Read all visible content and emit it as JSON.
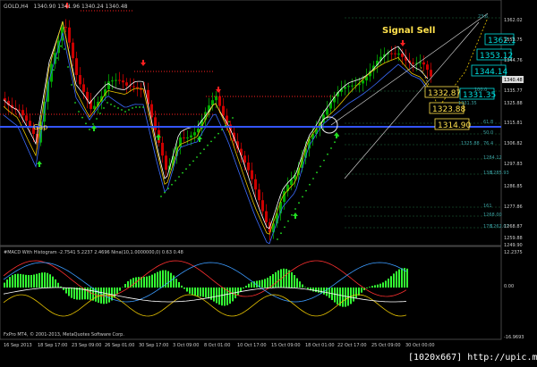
{
  "header": {
    "symbol": "GOLD,H4",
    "ohlc": "1340.90 1341.96 1340.24 1340.48"
  },
  "annotations": {
    "signal": "Signal Sell",
    "gap": "Gap"
  },
  "price_boxes": [
    {
      "label": "1362.1"
    },
    {
      "label": "1353.12"
    },
    {
      "label": "1344.14"
    },
    {
      "label": "1332.87"
    },
    {
      "label": "1331.35"
    },
    {
      "label": "1323.88"
    },
    {
      "label": "1314.90"
    }
  ],
  "current_price": "1340.48",
  "y_axis": [
    "1362.02",
    "1353.75",
    "1344.76",
    "1335.77",
    "1325.88",
    "1315.81",
    "1306.82",
    "1297.83",
    "1286.85",
    "1277.86",
    "1268.87",
    "1259.88",
    "1249.90"
  ],
  "fib_labels": [
    "23.6",
    "100.0",
    "61.8",
    "50.0",
    "76.4",
    "138",
    "161",
    "178"
  ],
  "fib_values": [
    "1331.35",
    "1325.88",
    "1284.12",
    "1285.93",
    "1268.00",
    "1262.07"
  ],
  "macd": {
    "title": "#MACD With Histogram -2.7541 5.2237 2.4696 Nina(10,1.0000000,0) 0.63 0.48",
    "y_axis": [
      "12.2375",
      "0.00",
      "-16.9693"
    ]
  },
  "footer": {
    "copyright": "FxPro MT4, © 2001-2013, MetaQuotes Software Corp.",
    "watermark": "[1020x667] http://upic.me/"
  },
  "x_axis": [
    "16 Sep 2013",
    "18 Sep 17:00",
    "23 Sep 09:00",
    "26 Sep 01:00",
    "30 Sep 17:00",
    "3 Oct 09:00",
    "8 Oct 01:00",
    "10 Oct 17:00",
    "15 Oct 09:00",
    "18 Oct 01:00",
    "22 Oct 17:00",
    "25 Oct 09:00",
    "30 Oct 00:00"
  ],
  "colors": {
    "background": "#000000",
    "bull_candle": "#00aa00",
    "bear_candle": "#cc0000",
    "ma_white": "#ffffff",
    "ma_yellow": "#e6c200",
    "ma_blue": "#3b6bff",
    "support_line": "#3355ff",
    "resistance_dots": "#ff2020",
    "psar_green": "#22dd22",
    "signal_text": "#ffe14d",
    "box_border": "#00e0e0",
    "histogram": "#33ff33"
  }
}
